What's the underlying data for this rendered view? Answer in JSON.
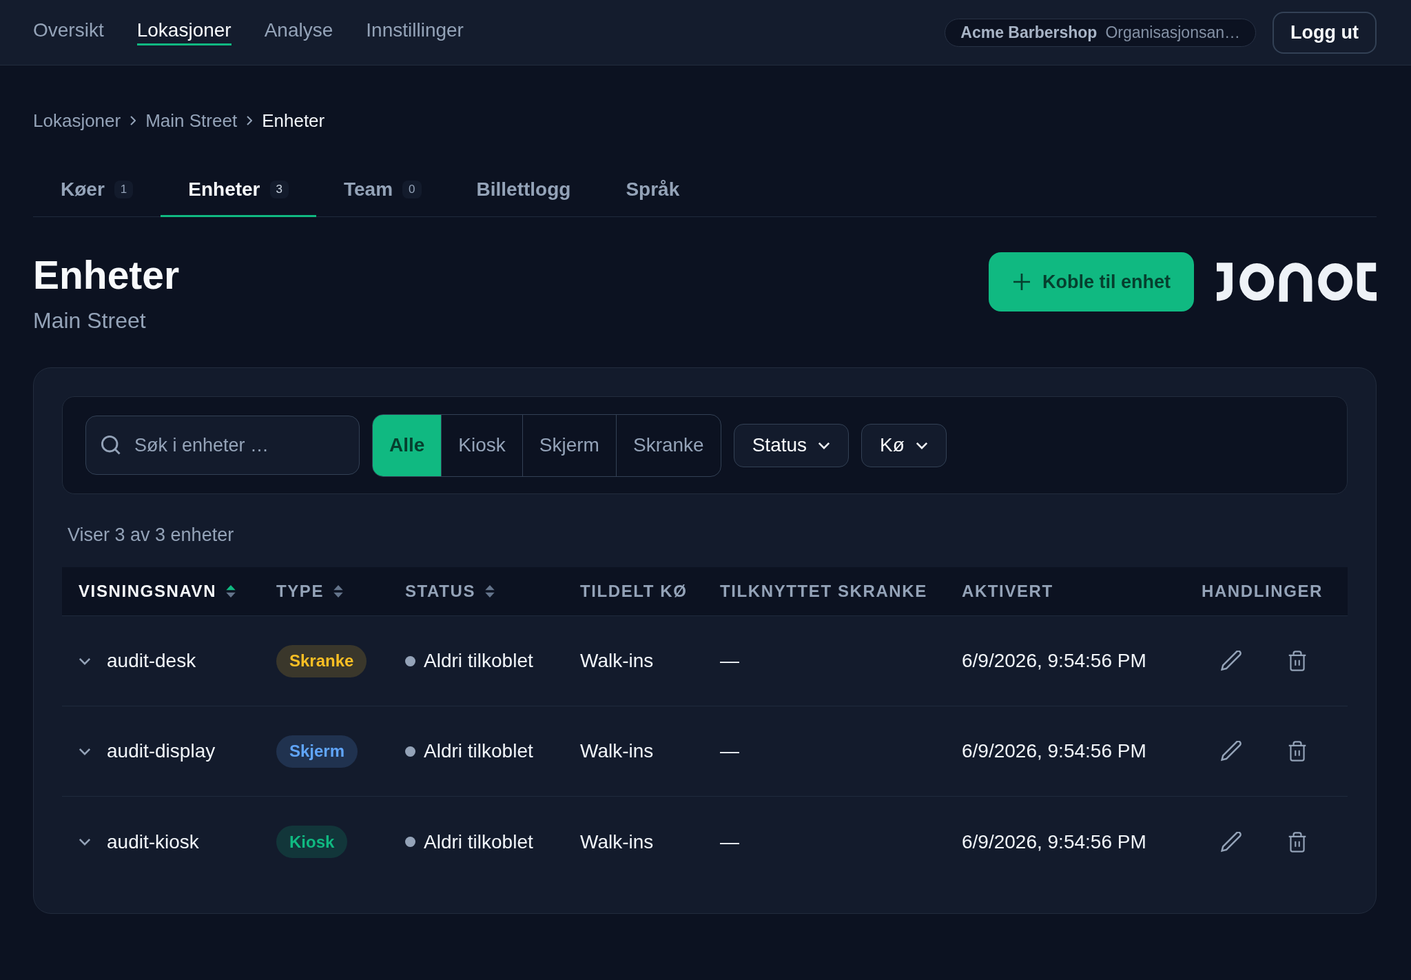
{
  "nav": {
    "items": [
      {
        "label": "Oversikt",
        "selected": false
      },
      {
        "label": "Lokasjoner",
        "selected": true
      },
      {
        "label": "Analyse",
        "selected": false
      },
      {
        "label": "Innstillinger",
        "selected": false
      }
    ]
  },
  "organization": {
    "name": "Acme Barbershop",
    "role": "Organisasjonsan…"
  },
  "logout_button": "Logg ut",
  "breadcrumb": [
    {
      "label": "Lokasjoner",
      "current": false
    },
    {
      "label": "Main Street",
      "current": false
    },
    {
      "label": "Enheter",
      "current": true
    }
  ],
  "tabs": [
    {
      "label": "Køer",
      "count": "1",
      "selected": false
    },
    {
      "label": "Enheter",
      "count": "3",
      "selected": true
    },
    {
      "label": "Team",
      "count": "0",
      "selected": false
    },
    {
      "label": "Billettlogg",
      "selected": false
    },
    {
      "label": "Språk",
      "selected": false
    }
  ],
  "page": {
    "title": "Enheter",
    "subtitle": "Main Street",
    "primary_button": "Koble til enhet"
  },
  "filters": {
    "search": {
      "placeholder": "Søk i enheter …"
    },
    "type_segments": [
      {
        "label": "Alle",
        "selected": true
      },
      {
        "label": "Kiosk",
        "selected": false
      },
      {
        "label": "Skjerm",
        "selected": false
      },
      {
        "label": "Skranke",
        "selected": false
      }
    ],
    "dropdowns": [
      "Status",
      "Kø"
    ]
  },
  "result_count": "Viser 3 av 3 enheter",
  "table": {
    "columns": [
      {
        "label": "VISNINGSNAVN",
        "sortable": true,
        "sorted": true
      },
      {
        "label": "TYPE",
        "sortable": true,
        "sorted": false
      },
      {
        "label": "STATUS",
        "sortable": true,
        "sorted": false
      },
      {
        "label": "TILDELT KØ",
        "sortable": false,
        "sorted": false
      },
      {
        "label": "TILKNYTTET SKRANKE",
        "sortable": false,
        "sorted": false
      },
      {
        "label": "AKTIVERT",
        "sortable": false,
        "sorted": false
      },
      {
        "label": "HANDLINGER",
        "sortable": false,
        "sorted": false
      }
    ],
    "rows": [
      {
        "name": "audit-desk",
        "expanded": false,
        "type": {
          "label": "Skranke",
          "color": "#fbbf24"
        },
        "status": "Aldri tilkoblet",
        "queue": "Walk-ins",
        "counter": "—",
        "activated": "6/9/2026, 9:54:56 PM"
      },
      {
        "name": "audit-display",
        "expanded": false,
        "type": {
          "label": "Skjerm",
          "color": "#60a5fa"
        },
        "status": "Aldri tilkoblet",
        "queue": "Walk-ins",
        "counter": "—",
        "activated": "6/9/2026, 9:54:56 PM"
      },
      {
        "name": "audit-kiosk",
        "expanded": false,
        "type": {
          "label": "Kiosk",
          "color": "#10b981"
        },
        "status": "Aldri tilkoblet",
        "queue": "Walk-ins",
        "counter": "—",
        "activated": "6/9/2026, 9:54:56 PM"
      }
    ]
  }
}
